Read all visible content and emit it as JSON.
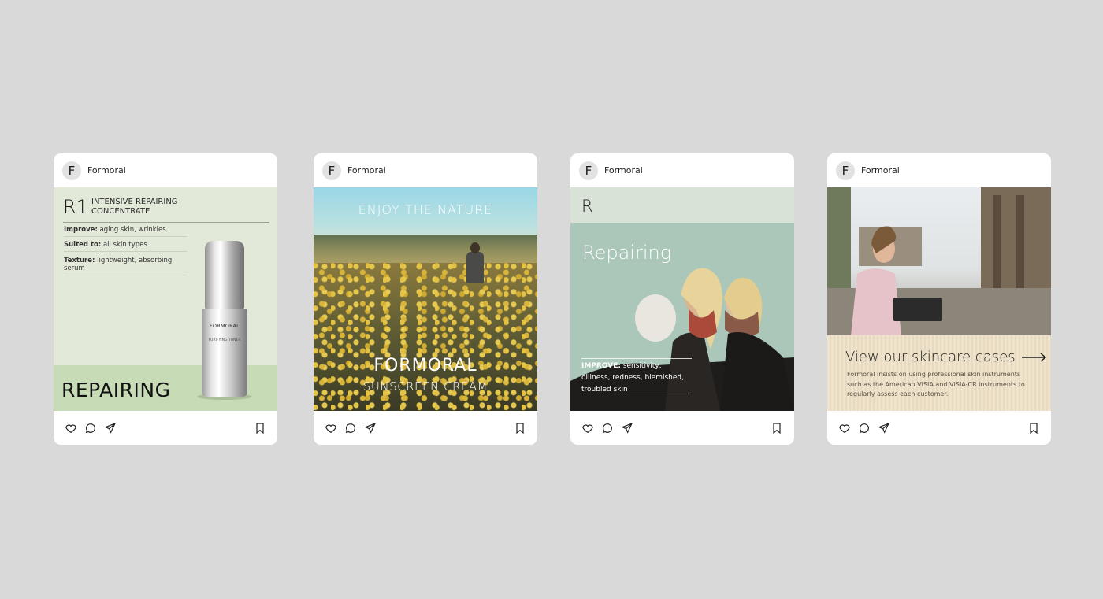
{
  "cards": [
    {
      "account": "Formoral",
      "avatar": "F",
      "product_code": "R1",
      "product_title": "INTENSIVE REPAIRING CONCENTRATE",
      "specs": [
        {
          "label": "Improve:",
          "value": " aging skin, wrinkles"
        },
        {
          "label": "Suited to:",
          "value": " all skin types"
        },
        {
          "label": "Texture:",
          "value": " lightweight, absorbing serum"
        }
      ],
      "bottle_brand": "FORMORAL",
      "bottle_sub": "PURIFYING TONER",
      "headline": "REPAIRING"
    },
    {
      "account": "Formoral",
      "avatar": "F",
      "tagline": "ENJOY THE NATURE",
      "brand": "FORMORAL",
      "product": "SUNSCREEN CREAM"
    },
    {
      "account": "Formoral",
      "avatar": "F",
      "letter": "R",
      "title": "Repairing",
      "improve_label": "IMPROVE:",
      "improve_text": " sensitivity, oiliness, redness, blemished, troubled skin"
    },
    {
      "account": "Formoral",
      "avatar": "F",
      "cta": "View our skincare cases",
      "body": "Formoral insists on using professional skin instruments such as the American VISIA and VISIA-CR instruments to regularly assess each customer."
    }
  ],
  "icons": [
    "heart-icon",
    "comment-icon",
    "send-icon",
    "bookmark-icon"
  ],
  "colors": {
    "background": "#d9d9d9",
    "card1_top": "#e2e9d9",
    "card1_bottom": "#c7dbb6",
    "card3_main": "#aac7b9",
    "card4_bottom": "#efe3cc"
  }
}
